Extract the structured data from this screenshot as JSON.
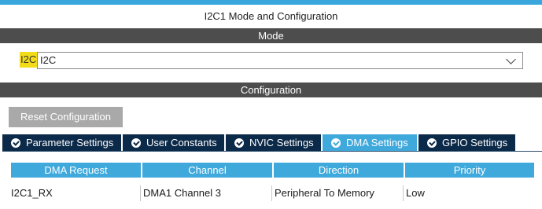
{
  "window": {
    "title": "I2C1 Mode and Configuration"
  },
  "mode_section": {
    "header": "Mode",
    "field_label": "I2C",
    "selected_value": "I2C"
  },
  "config_section": {
    "header": "Configuration",
    "reset_button": "Reset Configuration",
    "tabs": [
      {
        "label": "Parameter Settings",
        "active": false
      },
      {
        "label": "User Constants",
        "active": false
      },
      {
        "label": "NVIC Settings",
        "active": false
      },
      {
        "label": "DMA Settings",
        "active": true
      },
      {
        "label": "GPIO Settings",
        "active": false
      }
    ]
  },
  "dma_table": {
    "columns": [
      "DMA Request",
      "Channel",
      "Direction",
      "Priority"
    ],
    "rows": [
      [
        "I2C1_RX",
        "DMA1 Channel 3",
        "Peripheral To Memory",
        "Low"
      ]
    ]
  },
  "colors": {
    "accent": "#39a7dc",
    "section_bar": "#4d4d4d",
    "tab_inactive": "#0b2948",
    "tab_active": "#3fa9dc",
    "highlight": "#f2dc18"
  },
  "icons": {
    "tab_icon": "check-circle-icon",
    "select_arrow": "chevron-down-icon"
  }
}
